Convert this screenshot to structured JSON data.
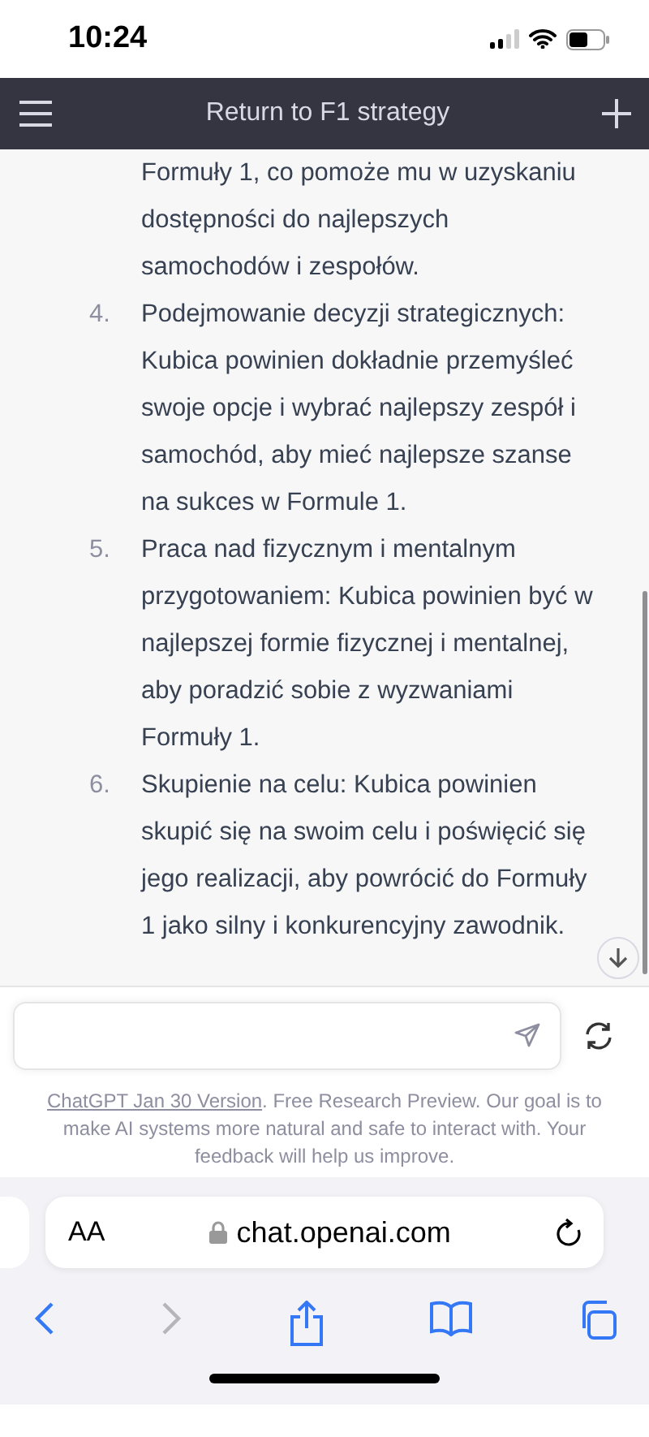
{
  "status_bar": {
    "time": "10:24"
  },
  "header": {
    "title": "Return to F1 strategy"
  },
  "message": {
    "continuation": "Formuły 1, co pomoże mu w uzyskaniu dostępności do najlepszych samochodów i zespołów.",
    "items": [
      {
        "number": "4.",
        "text": "Podejmowanie decyzji strategicznych: Kubica powinien dokładnie przemyśleć swoje opcje i wybrać najlepszy zespół i samochód, aby mieć najlepsze szanse na sukces w Formule 1."
      },
      {
        "number": "5.",
        "text": "Praca nad fizycznym i mentalnym przygotowaniem: Kubica powinien być w najlepszej formie fizycznej i mentalnej, aby poradzić sobie z wyzwaniami Formuły 1."
      },
      {
        "number": "6.",
        "text": "Skupienie na celu: Kubica powinien skupić się na swoim celu i poświęcić się jego realizacji, aby powrócić do Formuły 1 jako silny i konkurencyjny zawodnik."
      }
    ]
  },
  "composer": {
    "footer_link": "ChatGPT Jan 30 Version",
    "footer_text": ". Free Research Preview. Our goal is to make AI systems more natural and safe to interact with. Your feedback will help us improve."
  },
  "browser": {
    "text_size": "AA",
    "url": "chat.openai.com",
    "back": {
      "disabled": false
    },
    "forward": {
      "disabled": true
    }
  }
}
